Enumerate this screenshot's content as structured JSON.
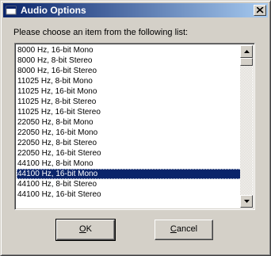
{
  "window": {
    "title": "Audio Options",
    "icons": {
      "app": "app-window-icon",
      "close": "close-icon"
    }
  },
  "dialog": {
    "prompt": "Please choose an item from the following list:",
    "list": {
      "items": [
        "8000 Hz, 16-bit Mono",
        "8000 Hz, 8-bit Stereo",
        "8000 Hz, 16-bit Stereo",
        "11025 Hz, 8-bit Mono",
        "11025 Hz, 16-bit Mono",
        "11025 Hz, 8-bit Stereo",
        "11025 Hz, 16-bit Stereo",
        "22050 Hz, 8-bit Mono",
        "22050 Hz, 16-bit Mono",
        "22050 Hz, 8-bit Stereo",
        "22050 Hz, 16-bit Stereo",
        "44100 Hz, 8-bit Mono",
        "44100 Hz, 16-bit Mono",
        "44100 Hz, 8-bit Stereo",
        "44100 Hz, 16-bit Stereo"
      ],
      "selected_index": 12
    },
    "buttons": {
      "ok_prefix": "",
      "ok_mnemonic": "O",
      "ok_suffix": "K",
      "cancel_prefix": "",
      "cancel_mnemonic": "C",
      "cancel_suffix": "ancel"
    }
  },
  "colors": {
    "selection": "#0a246a",
    "titlebar_start": "#0a246a",
    "titlebar_end": "#a6caf0",
    "face": "#d4d0c8"
  }
}
